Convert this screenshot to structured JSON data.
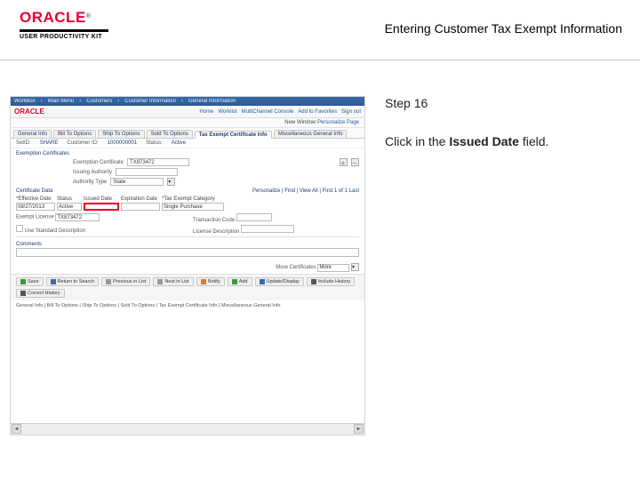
{
  "header": {
    "brand": "ORACLE",
    "tm": "®",
    "product": "USER PRODUCTIVITY KIT",
    "title": "Entering Customer Tax Exempt Information"
  },
  "instruction": {
    "step_label": "Step 16",
    "prefix": "Click in the ",
    "bold": "Issued Date",
    "suffix": " field."
  },
  "app": {
    "crumbs": [
      "Workbox",
      "Main Menu",
      "Customers",
      "Customer Information",
      "General Information"
    ],
    "brand": "ORACLE",
    "navlinks": [
      "Home",
      "Worklist",
      "MultiChannel Console",
      "Add to Favorites",
      "Sign out"
    ],
    "subnav_label": "New Window",
    "subnav_link": "Personalize Page",
    "tabs": {
      "items": [
        "General Info",
        "Bill To Options",
        "Ship To Options",
        "Sold To Options",
        "Tax Exempt Certificate Info",
        "Miscellaneous General Info"
      ],
      "active_index": 4
    },
    "inforow": {
      "setid_lbl": "SetID:",
      "setid_val": "SHARE",
      "cust_lbl": "Customer ID:",
      "cust_val": "1000000001",
      "status_lbl": "Status:",
      "status_val": "Active"
    },
    "section1_title": "Exemption Certificates",
    "cert_label": "Exemption Certificate",
    "cert_value": "TX873472",
    "auth_label": "Issuing Authority",
    "authtype_label": "Authority Type",
    "authtype_value": "State",
    "certdata_title": "Certificate Data",
    "meta_right": {
      "pers_label": "Personalize | Find | View All |",
      "first_label": "First",
      "range": "1 of 1",
      "last_label": "Last"
    },
    "grid_headers": [
      "*Effective Date",
      "Status",
      "Issued Date",
      "Expiration Date",
      "*Tax Exempt Category"
    ],
    "grid_row": {
      "eff": "08/27/2013",
      "status": "Active",
      "issued": "",
      "category": "Single Purchase"
    },
    "right_meta_rows": {
      "exempt_lbl": "Exempt License",
      "tcode_lbl": "Transaction Code",
      "exempt_val": "TX873472",
      "use_lbl": "Use Standard Description",
      "lic_lbl": "License Description"
    },
    "comments_label": "Comments",
    "more_lbl": "More Certificates",
    "more_val": "More",
    "toolbar": [
      "Save",
      "Return to Search",
      "Previous in List",
      "Next in List",
      "Notify",
      "Add",
      "Update/Display",
      "Include History",
      "Correct History"
    ],
    "descline": "General Info | Bill To Options | Ship To Options | Sold To Options | Tax Exempt Certificate Info | Miscellaneous General Info"
  }
}
